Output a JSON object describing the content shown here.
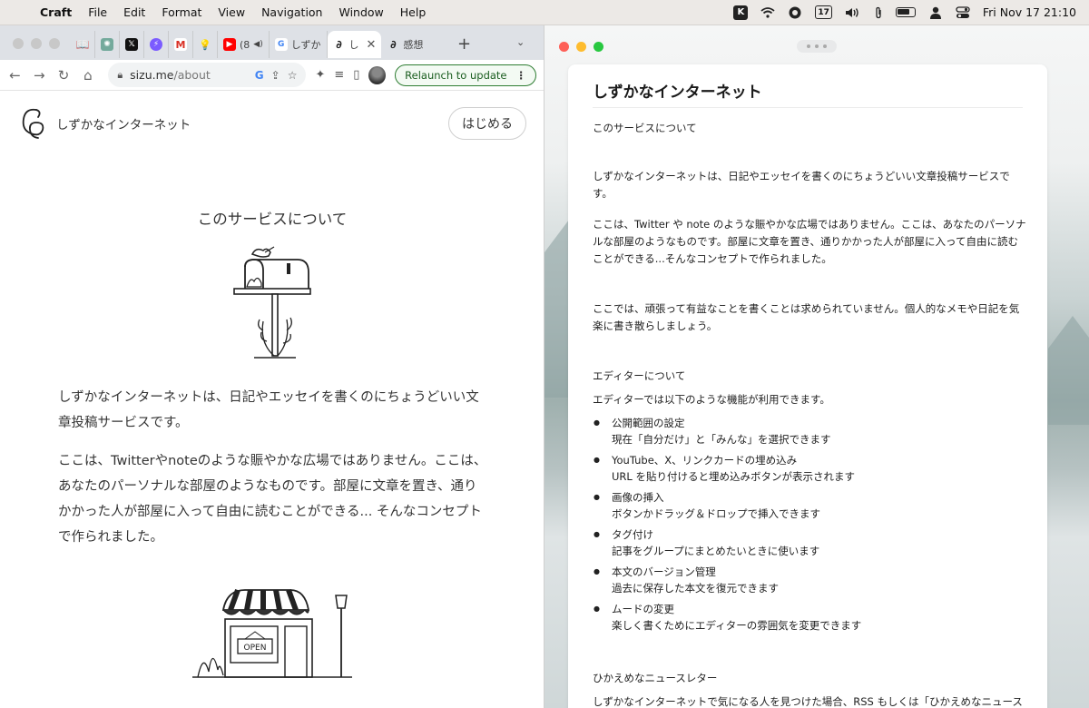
{
  "menubar": {
    "app_name": "Craft",
    "menus": [
      "File",
      "Edit",
      "Format",
      "View",
      "Navigation",
      "Window",
      "Help"
    ],
    "status_badge": "17",
    "status_letter": "K",
    "clock": "Fri Nov 17  21:10"
  },
  "browser": {
    "tabs": [
      {
        "label": "",
        "icon": "book-icon"
      },
      {
        "label": "",
        "icon": "chatgpt-icon"
      },
      {
        "label": "",
        "icon": "x-icon"
      },
      {
        "label": "",
        "icon": "messenger-icon"
      },
      {
        "label": "",
        "icon": "gmail-icon"
      },
      {
        "label": "",
        "icon": "bulb-icon"
      },
      {
        "label": "(8",
        "icon": "youtube-icon"
      },
      {
        "label": "しずか",
        "icon": "google-icon"
      },
      {
        "label": "し",
        "icon": "sizu-icon"
      },
      {
        "label": "感想",
        "icon": "sizu-icon"
      }
    ],
    "url_host": "sizu.me",
    "url_path": "/about",
    "relaunch_label": "Relaunch to update"
  },
  "site": {
    "name": "しずかなインターネット",
    "start_label": "はじめる",
    "about_title": "このサービスについて",
    "para1": "しずかなインターネットは、日記やエッセイを書くのにちょうどいい文章投稿サービスです。",
    "para2": "ここは、Twitterやnoteのような賑やかな広場ではありません。ここは、あなたのパーソナルな部屋のようなものです。部屋に文章を置き、通りかかった人が部屋に入って自由に読むことができる... そんなコンセプトで作られました。",
    "shop_sign": "OPEN"
  },
  "doc": {
    "title": "しずかなインターネット",
    "subtitle": "このサービスについて",
    "p1": "しずかなインターネットは、日記やエッセイを書くのにちょうどいい文章投稿サービスです。",
    "p2": "ここは、Twitter や note のような賑やかな広場ではありません。ここは、あなたのパーソナルな部屋のようなものです。部屋に文章を置き、通りかかった人が部屋に入って自由に読むことができる...そんなコンセプトで作られました。",
    "p3": "ここでは、頑張って有益なことを書くことは求められていません。個人的なメモや日記を気楽に書き散らしましょう。",
    "editor_heading": "エディターについて",
    "editor_intro": "エディターでは以下のような機能が利用できます。",
    "features": [
      {
        "title": "公開範囲の設定",
        "desc": "現在「自分だけ」と「みんな」を選択できます"
      },
      {
        "title": "YouTube、X、リンクカードの埋め込み",
        "desc": "URL を貼り付けると埋め込みボタンが表示されます"
      },
      {
        "title": "画像の挿入",
        "desc": "ボタンかドラッグ＆ドロップで挿入できます"
      },
      {
        "title": "タグ付け",
        "desc": "記事をグループにまとめたいときに使います"
      },
      {
        "title": "本文のバージョン管理",
        "desc": "過去に保存した本文を復元できます"
      },
      {
        "title": "ムードの変更",
        "desc": "楽しく書くためにエディターの雰囲気を変更できます"
      }
    ],
    "newsletter_heading": "ひかえめなニュースレター",
    "newsletter_text": "しずかなインターネットで気になる人を見つけた場合、RSS もしくは「ひかえめなニュース"
  }
}
